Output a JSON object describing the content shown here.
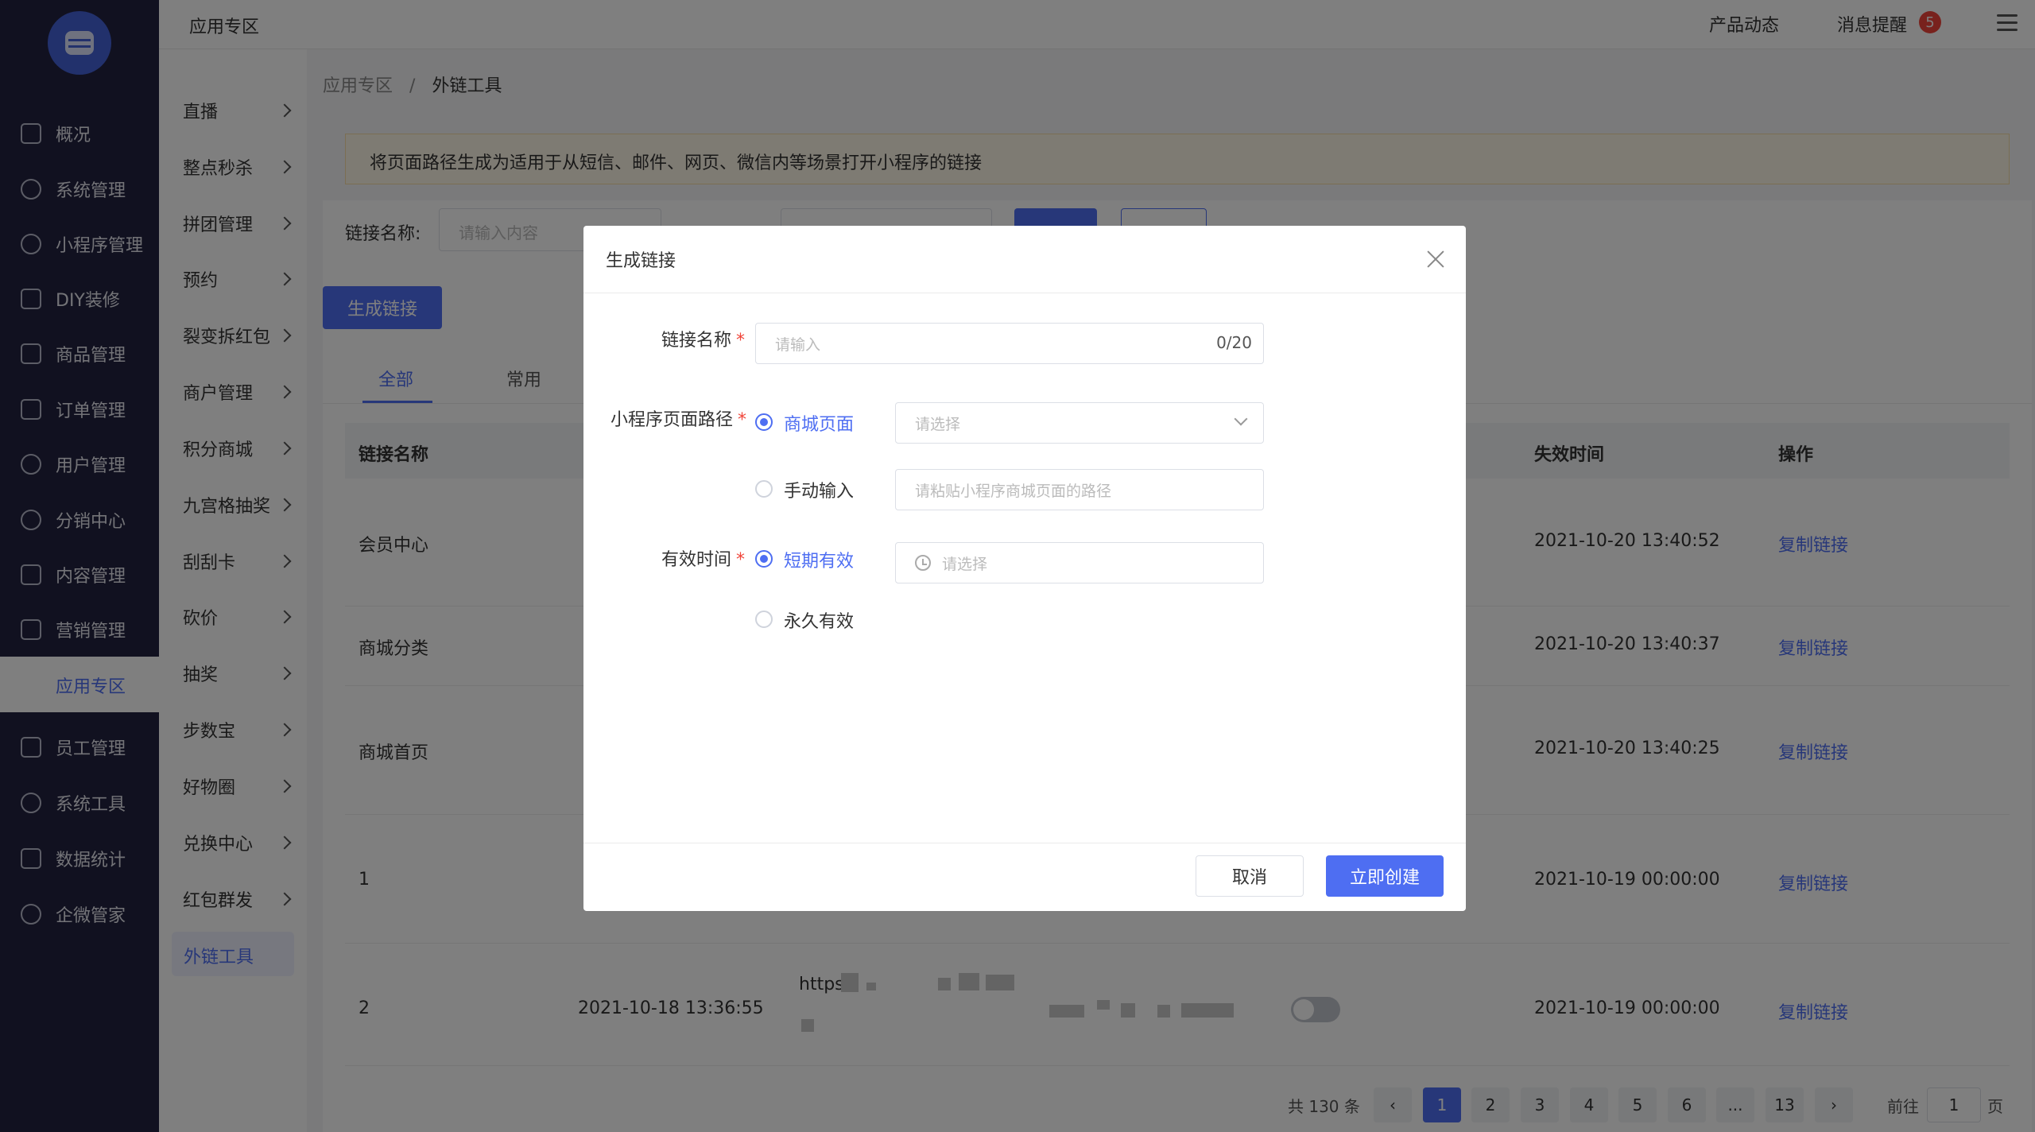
{
  "sidebar": {
    "items": [
      {
        "label": "概况"
      },
      {
        "label": "系统管理"
      },
      {
        "label": "小程序管理"
      },
      {
        "label": "DIY装修"
      },
      {
        "label": "商品管理"
      },
      {
        "label": "订单管理"
      },
      {
        "label": "用户管理"
      },
      {
        "label": "分销中心"
      },
      {
        "label": "内容管理"
      },
      {
        "label": "营销管理"
      },
      {
        "label": "应用专区"
      },
      {
        "label": "员工管理"
      },
      {
        "label": "系统工具"
      },
      {
        "label": "数据统计"
      },
      {
        "label": "企微管家"
      }
    ]
  },
  "submenu": {
    "items": [
      {
        "label": "直播"
      },
      {
        "label": "整点秒杀"
      },
      {
        "label": "拼团管理"
      },
      {
        "label": "预约"
      },
      {
        "label": "裂变拆红包"
      },
      {
        "label": "商户管理"
      },
      {
        "label": "积分商城"
      },
      {
        "label": "九宫格抽奖"
      },
      {
        "label": "刮刮卡"
      },
      {
        "label": "砍价"
      },
      {
        "label": "抽奖"
      },
      {
        "label": "步数宝"
      },
      {
        "label": "好物圈"
      },
      {
        "label": "兑换中心"
      },
      {
        "label": "红包群发"
      },
      {
        "label": "外链工具"
      }
    ]
  },
  "header": {
    "title": "应用专区",
    "product_news": "产品动态",
    "messages": "消息提醒",
    "message_count": "5"
  },
  "breadcrumb": {
    "parent": "应用专区",
    "separator": "/",
    "current": "外链工具"
  },
  "notice": "将页面路径生成为适用于从短信、邮件、网页、微信内等场景打开小程序的链接",
  "filter": {
    "name_label": "链接名称:",
    "name_placeholder": "请输入内容"
  },
  "generate_button": "生成链接",
  "tabs": [
    {
      "label": "全部"
    },
    {
      "label": "常用"
    }
  ],
  "table": {
    "headers": {
      "name": "链接名称",
      "expire": "失效时间",
      "action": "操作"
    },
    "rows": [
      {
        "name": "会员中心",
        "expire": "2021-10-20 13:40:52",
        "action": "复制链接"
      },
      {
        "name": "商城分类",
        "expire": "2021-10-20 13:40:37",
        "action": "复制链接"
      },
      {
        "name": "商城首页",
        "expire": "2021-10-20 13:40:25",
        "action": "复制链接"
      },
      {
        "name": "1",
        "expire": "2021-10-19 00:00:00",
        "action": "复制链接"
      },
      {
        "name": "2",
        "created": "2021-10-18 13:36:55",
        "link_prefix": "https",
        "expire": "2021-10-19 00:00:00",
        "action": "复制链接"
      }
    ]
  },
  "pagination": {
    "total": "共 130 条",
    "pages": [
      "1",
      "2",
      "3",
      "4",
      "5",
      "6",
      "...",
      "13"
    ],
    "current": "1",
    "goto_label": "前往",
    "goto_value": "1",
    "page_unit": "页"
  },
  "dialog": {
    "title": "生成链接",
    "name_label": "链接名称",
    "name_placeholder": "请输入",
    "name_counter": "0/20",
    "path_label": "小程序页面路径",
    "path_option_mall": "商城页面",
    "path_select_placeholder": "请选择",
    "path_option_manual": "手动输入",
    "path_manual_placeholder": "请粘贴小程序商城页面的路径",
    "time_label": "有效时间",
    "time_option_short": "短期有效",
    "time_select_placeholder": "请选择",
    "time_option_forever": "永久有效",
    "required_mark": "*",
    "cancel": "取消",
    "confirm": "立即创建"
  },
  "colors": {
    "primary": "#4e6ef2",
    "sidebar": "#222340",
    "danger": "#f0453a",
    "notice_bg": "#fdf6e6"
  }
}
